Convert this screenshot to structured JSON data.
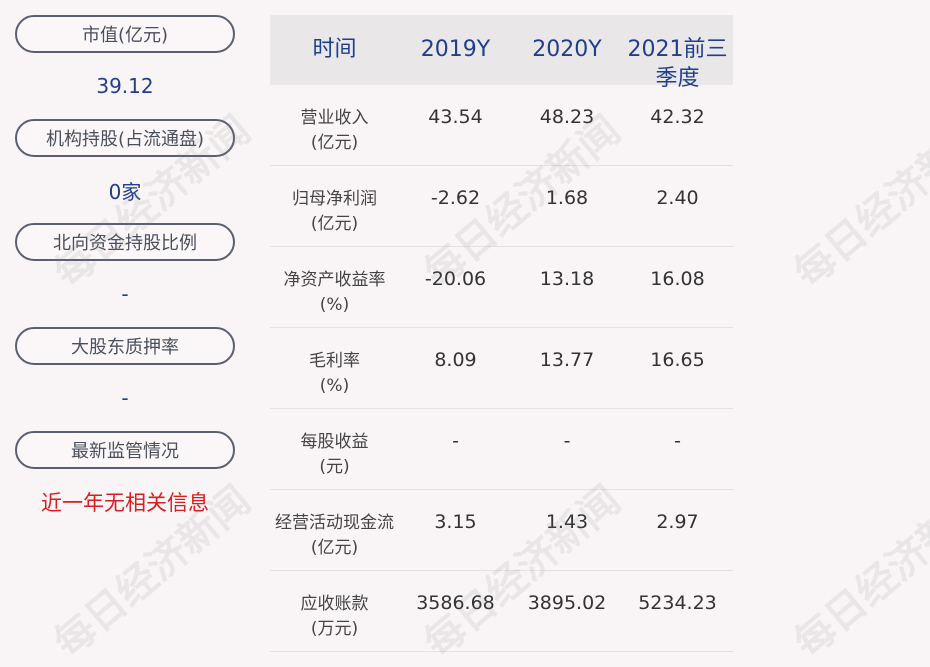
{
  "left": [
    {
      "label": "市值(亿元)",
      "value": "39.12",
      "red": false
    },
    {
      "label": "机构持股(占流通盘)",
      "value": "0家",
      "red": false
    },
    {
      "label": "北向资金持股比例",
      "value": "-",
      "red": false
    },
    {
      "label": "大股东质押率",
      "value": "-",
      "red": false
    },
    {
      "label": "最新监管情况",
      "value": "近一年无相关信息",
      "red": true
    }
  ],
  "table": {
    "headers": [
      "时间",
      "2019Y",
      "2020Y",
      "2021前三\n季度"
    ],
    "rows": [
      {
        "label": "营业收入\n(亿元)",
        "values": [
          "43.54",
          "48.23",
          "42.32"
        ]
      },
      {
        "label": "归母净利润\n(亿元)",
        "values": [
          "-2.62",
          "1.68",
          "2.40"
        ]
      },
      {
        "label": "净资产收益率\n(%)",
        "values": [
          "-20.06",
          "13.18",
          "16.08"
        ]
      },
      {
        "label": "毛利率\n(%)",
        "values": [
          "8.09",
          "13.77",
          "16.65"
        ]
      },
      {
        "label": "每股收益\n(元)",
        "values": [
          "-",
          "-",
          "-"
        ]
      },
      {
        "label": "经营活动现金流\n(亿元)",
        "values": [
          "3.15",
          "1.43",
          "2.97"
        ]
      },
      {
        "label": "应收账款\n(万元)",
        "values": [
          "3586.68",
          "3895.02",
          "5234.23"
        ]
      }
    ]
  },
  "watermark": "每日经济新闻"
}
